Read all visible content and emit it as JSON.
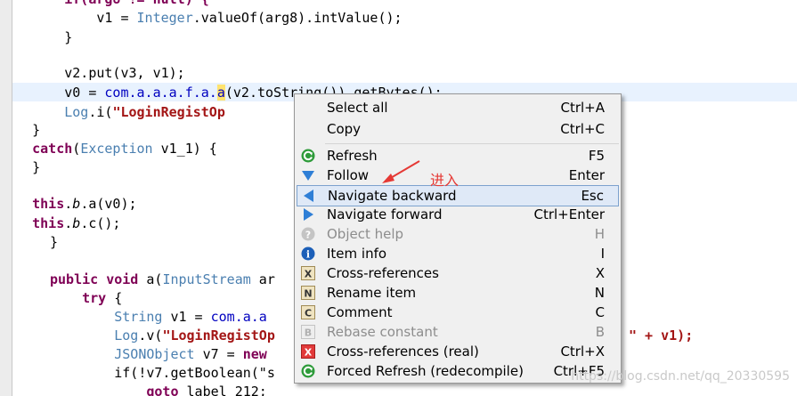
{
  "code": {
    "l1": "        if(arg8 != null) {",
    "l2a": "            v1 = ",
    "l2b": "Integer",
    "l2c": ".valueOf(arg8).intValue();",
    "l3": "        }",
    "l5": "        v2.put(v3, v1);",
    "l6a": "        v0 = ",
    "l6b": "com.a.a.a.f.a.",
    "l6c": "a",
    "l6d": "(v2.toString()).getBytes();",
    "l7a": "        ",
    "l7b": "Log",
    "l7c": ".i(",
    "l7d": "\"LoginRegistOp",
    "l8": "    }",
    "l9a": "    ",
    "l9b": "catch",
    "l9c": "(",
    "l9d": "Exception",
    "l9e": " v1_1) {",
    "l10": "    }",
    "l12a": "    ",
    "l12b": "this",
    "l12c": ".",
    "l12d": "b",
    "l12e": ".a(v0);",
    "l13a": "    ",
    "l13b": "this",
    "l13c": ".",
    "l13d": "b",
    "l13e": ".c();",
    "l14": "}",
    "l16a": "public void",
    "l16b": " a(",
    "l16c": "InputStream",
    "l16d": " ar",
    "l17a": "    ",
    "l17b": "try",
    "l17c": " {",
    "l18a": "        ",
    "l18b": "String",
    "l18c": " v1 = ",
    "l18d": "com.a.a",
    "l19a": "        ",
    "l19b": "Log",
    "l19c": ".v(",
    "l19d": "\"LoginRegistOp",
    "l19e": "\" + v1);",
    "l20a": "        ",
    "l20b": "JSONObject",
    "l20c": " v7 = ",
    "l20d": "new",
    "l21a": "        if(!v7.getBoolean(\"s",
    "l22a": "            ",
    "l22b": "goto",
    "l22c": " label 212;"
  },
  "menu": {
    "items": [
      {
        "label": "Select all",
        "shortcut": "Ctrl+A",
        "icon": "none"
      },
      {
        "label": "Copy",
        "shortcut": "Ctrl+C",
        "icon": "none"
      },
      {
        "label": "Refresh",
        "shortcut": "F5",
        "icon": "refresh-icon"
      },
      {
        "label": "Follow",
        "shortcut": "Enter",
        "icon": "follow-icon"
      },
      {
        "label": "Navigate backward",
        "shortcut": "Esc",
        "icon": "back-arrow-icon"
      },
      {
        "label": "Navigate forward",
        "shortcut": "Ctrl+Enter",
        "icon": "forward-arrow-icon"
      },
      {
        "label": "Object help",
        "shortcut": "H",
        "icon": "help-icon",
        "disabled": true
      },
      {
        "label": "Item info",
        "shortcut": "I",
        "icon": "info-icon"
      },
      {
        "label": "Cross-references",
        "shortcut": "X",
        "icon": "xref-icon"
      },
      {
        "label": "Rename item",
        "shortcut": "N",
        "icon": "rename-icon"
      },
      {
        "label": "Comment",
        "shortcut": "C",
        "icon": "comment-icon"
      },
      {
        "label": "Rebase constant",
        "shortcut": "B",
        "icon": "rebase-icon",
        "disabled": true
      },
      {
        "label": "Cross-references (real)",
        "shortcut": "Ctrl+X",
        "icon": "xref-real-icon"
      },
      {
        "label": "Forced Refresh (redecompile)",
        "shortcut": "Ctrl+F5",
        "icon": "forced-refresh-icon"
      }
    ]
  },
  "annotation": "进入",
  "watermark": "https://blog.csdn.net/qq_20330595",
  "colors": {
    "annotation": "#e53935",
    "selection": "#dfe9f7"
  }
}
